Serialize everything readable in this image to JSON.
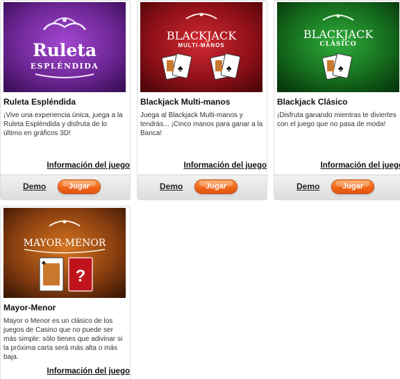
{
  "games": [
    {
      "title": "Ruleta Espléndida",
      "logo_lines": [
        "Ruleta",
        "ESPLÉNDIDA"
      ],
      "description": "¡Vive una experiencia única, juega a la Ruleta Espléndida y disfruta de lo último en gráficos 3D!",
      "info_link": "Información del juego",
      "demo_label": "Demo",
      "play_label": "Jugar"
    },
    {
      "title": "Blackjack Multi-manos",
      "logo_lines": [
        "BLACKJACK",
        "MULTI-MANOS"
      ],
      "description": "Juega al Blackjack Multi-manos y tendrás... ¡Cinco manos para ganar a la Banca!",
      "info_link": "Información del juego",
      "demo_label": "Demo",
      "play_label": "Jugar"
    },
    {
      "title": "Blackjack Clásico",
      "logo_lines": [
        "BLACKJACK",
        "CLÁSICO"
      ],
      "description": "¡Disfruta ganando mientras te diviertes con el juego que no pasa de moda!",
      "info_link": "Información del juego",
      "demo_label": "Demo",
      "play_label": "Jugar"
    },
    {
      "title": "Mayor-Menor",
      "logo_lines": [
        "MAYOR-MENOR",
        "?"
      ],
      "description": "Mayor o Menor es un clásico de los juegos de Casino que no puede ser más simple: sólo tienes que adivinar si la próxima carta será más alta o más baja.",
      "info_link": "Información del juego"
    }
  ],
  "colors": {
    "play_button": "#f2661a",
    "ruleta_bg": "#7a2fa0",
    "multimanos_bg": "#a3141c",
    "clasico_bg": "#1d7a25",
    "mayormenor_bg": "#8a3f10"
  }
}
